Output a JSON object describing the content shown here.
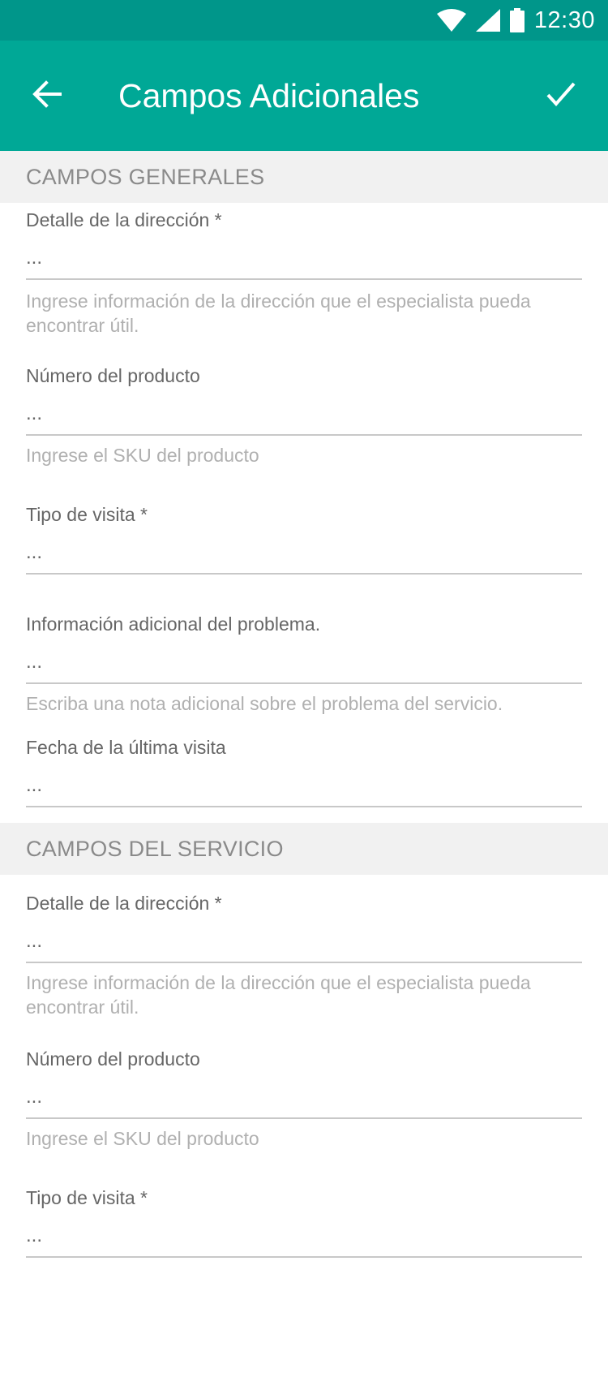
{
  "status_bar": {
    "time": "12:30",
    "icons": [
      "wifi-icon",
      "cell-signal-icon",
      "battery-icon"
    ]
  },
  "app_bar": {
    "title": "Campos Adicionales",
    "back_icon": "arrow-back-icon",
    "confirm_icon": "check-icon"
  },
  "sections": [
    {
      "title": "CAMPOS GENERALES",
      "fields": [
        {
          "label": "Detalle de la dirección *",
          "value": "...",
          "help": "Ingrese información de la dirección que el especialista pueda encontrar útil."
        },
        {
          "label": "Número del producto",
          "value": "...",
          "help": "Ingrese el SKU del producto"
        },
        {
          "label": "Tipo de visita *",
          "value": "...",
          "help": ""
        },
        {
          "label": "Información adicional del problema.",
          "value": "...",
          "help": "Escriba una nota adicional sobre el problema del servicio."
        },
        {
          "label": "Fecha de la última visita",
          "value": "...",
          "help": ""
        }
      ]
    },
    {
      "title": "CAMPOS DEL SERVICIO",
      "fields": [
        {
          "label": "Detalle de la dirección *",
          "value": "...",
          "help": "Ingrese información de la dirección que el especialista pueda encontrar útil."
        },
        {
          "label": "Número del producto",
          "value": "...",
          "help": "Ingrese el SKU del producto"
        },
        {
          "label": "Tipo de visita *",
          "value": "...",
          "help": ""
        }
      ]
    }
  ],
  "colors": {
    "status_bar": "#00968a",
    "app_bar": "#00a896",
    "section_bg": "#f1f1f1"
  }
}
